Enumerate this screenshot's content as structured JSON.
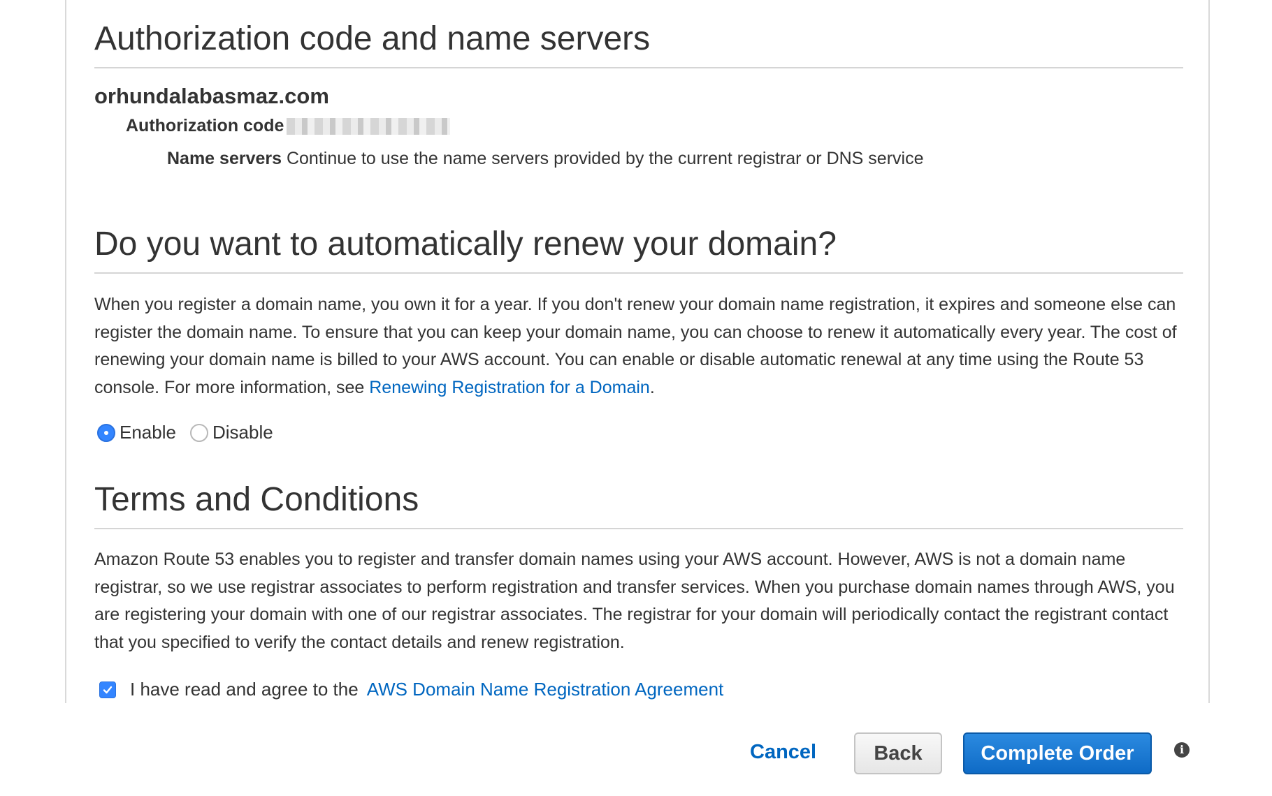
{
  "auth_section": {
    "heading": "Authorization code and name servers",
    "domain": "orhundalabasmaz.com",
    "auth_code_label": "Authorization code",
    "name_servers_label": "Name servers",
    "name_servers_value": "Continue to use the name servers provided by the current registrar or DNS service"
  },
  "renew_section": {
    "heading": "Do you want to automatically renew your domain?",
    "text": "When you register a domain name, you own it for a year. If you don't renew your domain name registration, it expires and someone else can register the domain name. To ensure that you can keep your domain name, you can choose to renew it automatically every year. The cost of renewing your domain name is billed to your AWS account. You can enable or disable automatic renewal at any time using the Route 53 console. For more information, see",
    "link": "Renewing Registration for a Domain",
    "after_link": ".",
    "enable_label": "Enable",
    "disable_label": "Disable",
    "selected": "Enable"
  },
  "terms_section": {
    "heading": "Terms and Conditions",
    "text": "Amazon Route 53 enables you to register and transfer domain names using your AWS account. However, AWS is not a domain name registrar, so we use registrar associates to perform registration and transfer services. When you purchase domain names through AWS, you are registering your domain with one of our registrar associates. The registrar for your domain will periodically contact the registrant contact that you specified to verify the contact details and renew registration.",
    "agree_text": "I have read and agree to the",
    "agree_link": "AWS Domain Name Registration Agreement",
    "agreed": true
  },
  "footer": {
    "cancel_label": "Cancel",
    "back_label": "Back",
    "complete_label": "Complete Order",
    "info_icon": "info-icon"
  },
  "colors": {
    "link": "#0066c0",
    "primary_button": "#1a7bd4",
    "radio_selected": "#3385ff"
  }
}
